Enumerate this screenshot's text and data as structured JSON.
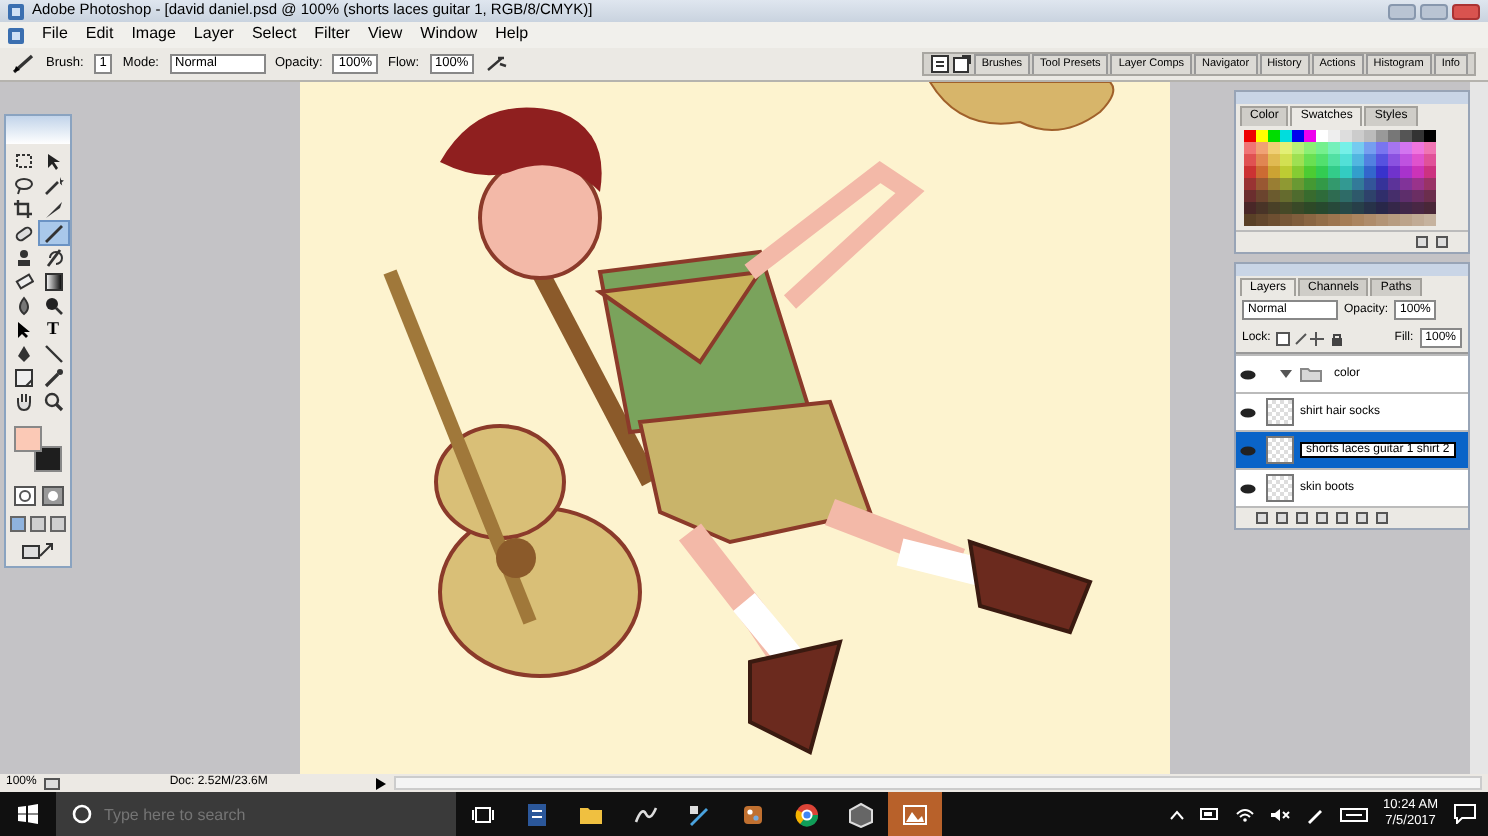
{
  "window": {
    "title": "Adobe Photoshop - [david daniel.psd @ 100% (shorts laces guitar 1, RGB/8/CMYK)]"
  },
  "menu": [
    "File",
    "Edit",
    "Image",
    "Layer",
    "Select",
    "Filter",
    "View",
    "Window",
    "Help"
  ],
  "options_bar": {
    "brush_label": "Brush:",
    "brush_size": "1",
    "mode_label": "Mode:",
    "mode": "Normal",
    "opacity_label": "Opacity:",
    "opacity": "100%",
    "flow_label": "Flow:",
    "flow": "100%"
  },
  "palette_well": [
    "Brushes",
    "Tool Presets",
    "Layer Comps",
    "Navigator",
    "History",
    "Actions",
    "Histogram",
    "Info"
  ],
  "tools": [
    {
      "selected": false
    },
    {
      "selected": false
    },
    {
      "selected": false
    },
    {
      "selected": false
    },
    {
      "selected": false
    },
    {
      "selected": false
    },
    {
      "selected": false
    },
    {
      "selected": true
    },
    {
      "selected": false
    },
    {
      "selected": false
    },
    {
      "selected": false
    },
    {
      "selected": false
    },
    {
      "selected": false
    },
    {
      "selected": false
    },
    {
      "selected": false
    },
    {
      "selected": false,
      "glyph": "T"
    },
    {
      "selected": false
    },
    {
      "selected": false
    },
    {
      "selected": false
    },
    {
      "selected": false
    },
    {
      "selected": false
    },
    {
      "selected": false
    }
  ],
  "swatches_panel": {
    "tabs": [
      {
        "label": "Color",
        "selected": false
      },
      {
        "label": "Swatches",
        "selected": true
      },
      {
        "label": "Styles",
        "selected": false
      }
    ]
  },
  "layers_panel": {
    "tabs": [
      {
        "label": "Layers",
        "selected": true
      },
      {
        "label": "Channels",
        "selected": false
      },
      {
        "label": "Paths",
        "selected": false
      }
    ],
    "blend_mode": "Normal",
    "opacity_label": "Opacity:",
    "opacity": "100%",
    "lock_label": "Lock:",
    "fill_label": "Fill:",
    "fill": "100%",
    "layers": [
      {
        "kind": "group",
        "name": "color",
        "visible": true,
        "expanded": true,
        "selected": false
      },
      {
        "kind": "layer",
        "name": "shirt hair socks",
        "visible": true,
        "selected": false
      },
      {
        "kind": "layer",
        "name": "shorts laces guitar 1 shirt 2",
        "visible": true,
        "selected": true
      },
      {
        "kind": "layer",
        "name": "skin boots",
        "visible": true,
        "selected": false
      }
    ]
  },
  "status_bar": {
    "zoom": "100%",
    "doc": "Doc: 2.52M/23.6M"
  },
  "taskbar": {
    "search_placeholder": "Type here to search",
    "apps": [
      {
        "selected": false
      },
      {
        "selected": false
      },
      {
        "selected": false
      },
      {
        "selected": false
      },
      {
        "selected": false
      },
      {
        "selected": false
      },
      {
        "selected": false
      },
      {
        "selected": true
      }
    ],
    "time": "10:24 AM",
    "date": "7/5/2017"
  }
}
